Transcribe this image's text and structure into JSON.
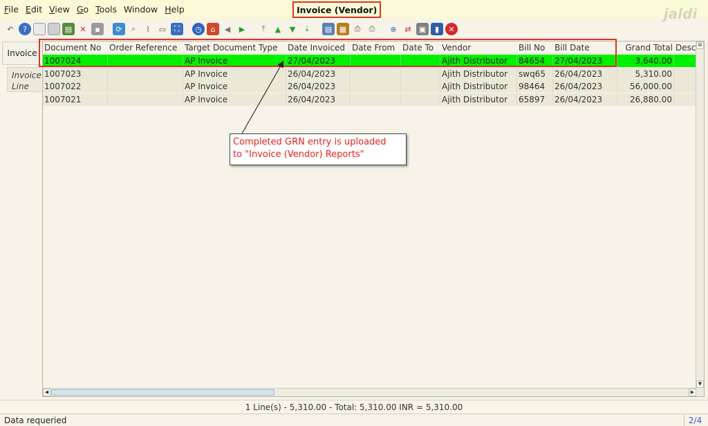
{
  "menu": [
    {
      "underline": "F",
      "rest": "ile"
    },
    {
      "underline": "E",
      "rest": "dit"
    },
    {
      "underline": "V",
      "rest": "iew"
    },
    {
      "underline": "G",
      "rest": "o"
    },
    {
      "underline": "T",
      "rest": "ools"
    },
    {
      "underline": "",
      "rest": "Window"
    },
    {
      "underline": "H",
      "rest": "elp"
    }
  ],
  "window_title": "Invoice (Vendor)",
  "logo_text": "jaldi",
  "toolbar": {
    "icons": [
      "undo-icon",
      "help-icon",
      "new-icon",
      "copy-icon",
      "save-icon",
      "delete-icon",
      "save-disabled-icon",
      "refresh-icon",
      "find-icon",
      "attachment-icon",
      "chat-icon",
      "grid-toggle-icon",
      "history-icon",
      "home-icon",
      "back-icon",
      "forward-icon",
      "first-record-icon",
      "previous-record-icon",
      "next-record-icon",
      "last-record-icon",
      "report-icon",
      "archive-icon",
      "print-preview-icon",
      "print-icon",
      "zoom-icon",
      "workflow-icon",
      "product-icon",
      "requests-icon",
      "close-window-icon"
    ]
  },
  "tabs": {
    "invoice": "Invoice",
    "invoice_line_1": "Invoice",
    "invoice_line_2": "Line"
  },
  "grid": {
    "columns": [
      "Document No",
      "Order Reference",
      "Target Document Type",
      "Date Invoiced",
      "Date From",
      "Date To",
      "Vendor",
      "Bill No",
      "Bill Date",
      "Grand Total",
      "Descri"
    ],
    "rows": [
      {
        "doc_no": "1007024",
        "order_ref": "",
        "target_type": "AP Invoice",
        "date_invoiced": "27/04/2023",
        "date_from": "",
        "date_to": "",
        "vendor": "Ajith Distributor",
        "bill_no": "84654",
        "bill_date": "27/04/2023",
        "grand_total": "3,640.00",
        "selected": true
      },
      {
        "doc_no": "1007023",
        "order_ref": "",
        "target_type": "AP Invoice",
        "date_invoiced": "26/04/2023",
        "date_from": "",
        "date_to": "",
        "vendor": "Ajith Distributor",
        "bill_no": "swq65",
        "bill_date": "26/04/2023",
        "grand_total": "5,310.00",
        "selected": false
      },
      {
        "doc_no": "1007022",
        "order_ref": "",
        "target_type": "AP Invoice",
        "date_invoiced": "26/04/2023",
        "date_from": "",
        "date_to": "",
        "vendor": "Ajith Distributor",
        "bill_no": "98464",
        "bill_date": "26/04/2023",
        "grand_total": "56,000.00",
        "selected": false
      },
      {
        "doc_no": "1007021",
        "order_ref": "",
        "target_type": "AP Invoice",
        "date_invoiced": "26/04/2023",
        "date_from": "",
        "date_to": "",
        "vendor": "Ajith Distributor",
        "bill_no": "65897",
        "bill_date": "26/04/2023",
        "grand_total": "26,880.00",
        "selected": false
      }
    ]
  },
  "callout": {
    "line1": "Completed GRN entry is uploaded",
    "line2": "to \"Invoice (Vendor) Reports\""
  },
  "summary": "1 Line(s) - 5,310.00 -  Total: 5,310.00  INR  =  5,310.00",
  "status": {
    "text": "Data requeried",
    "page": "2/4"
  },
  "colors": {
    "selected_row": "#00f000",
    "annotation_red": "#d9352a"
  }
}
